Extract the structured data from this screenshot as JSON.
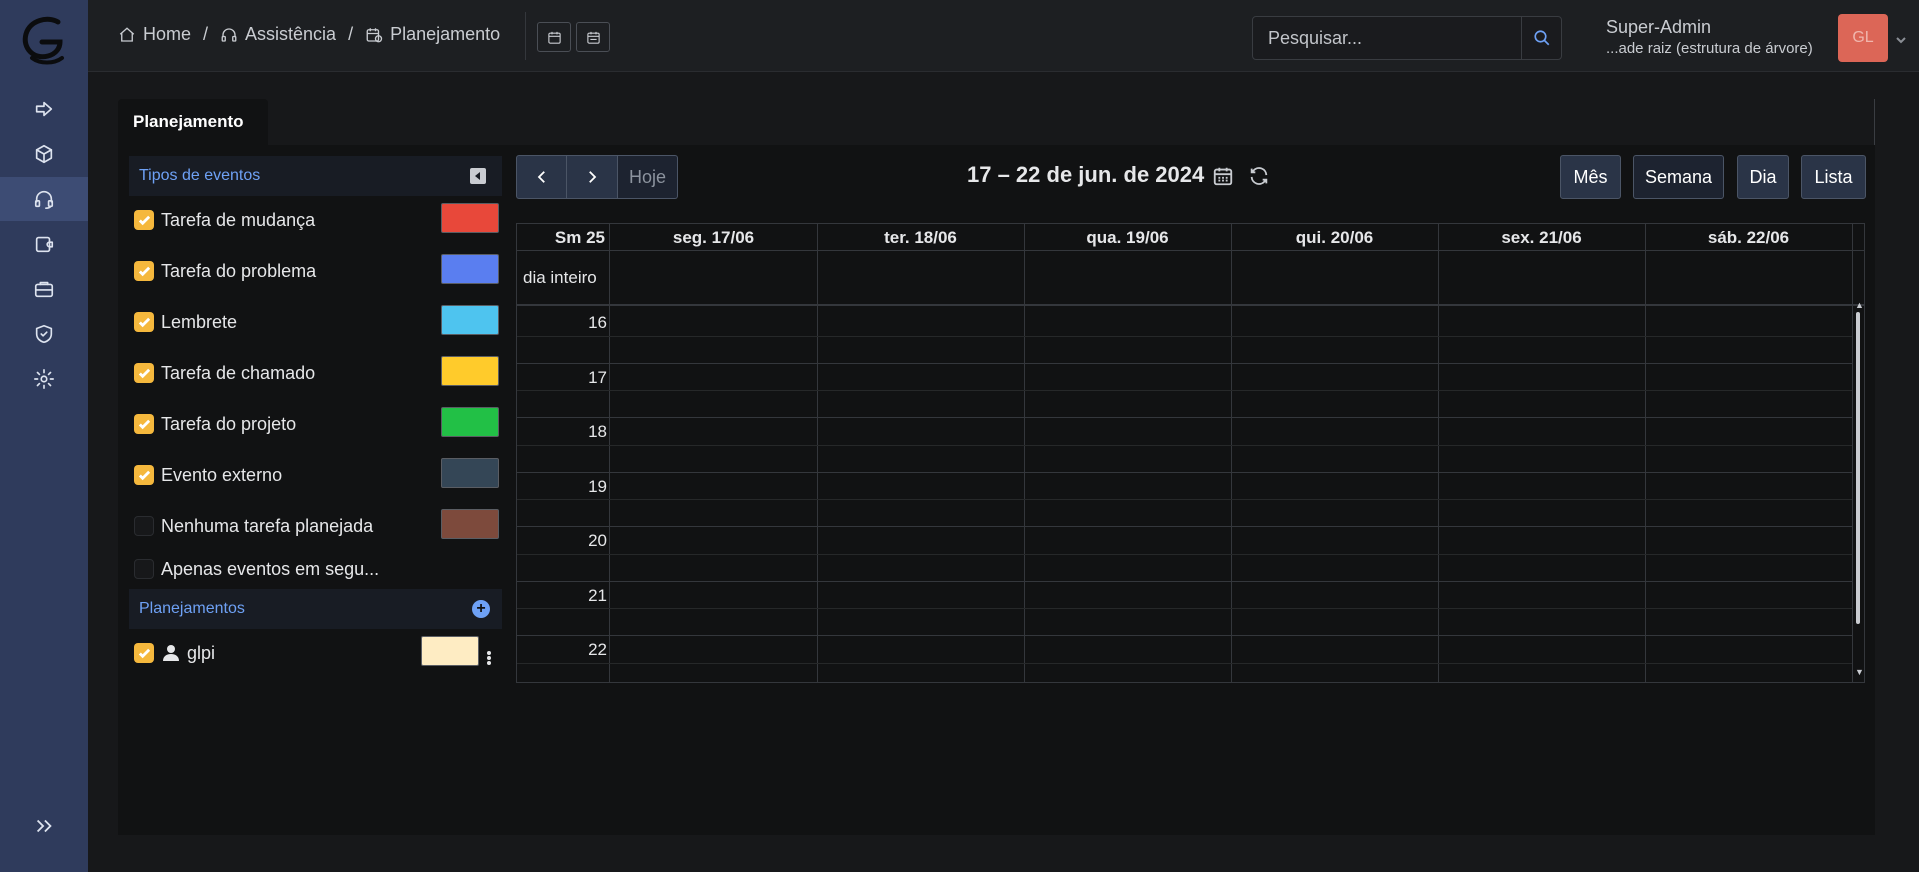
{
  "breadcrumb": {
    "home": "Home",
    "assistance": "Assistência",
    "planning": "Planejamento"
  },
  "search": {
    "placeholder": "Pesquisar..."
  },
  "user": {
    "name": "Super-Admin",
    "entity": "...ade raiz (estrutura de árvore)",
    "initials": "GL",
    "avatar_color": "#dc6657"
  },
  "sidebar": {
    "items": [
      {
        "icon": "arrow-right-icon"
      },
      {
        "icon": "box-icon"
      },
      {
        "icon": "headset-icon",
        "active": true
      },
      {
        "icon": "wallet-icon"
      },
      {
        "icon": "briefcase-icon"
      },
      {
        "icon": "shield-icon"
      },
      {
        "icon": "gear-icon"
      }
    ],
    "expand_icon": "chevrons-right-icon"
  },
  "tab": {
    "label": "Planejamento"
  },
  "filters": {
    "event_types_header": "Tipos de eventos",
    "event_types": [
      {
        "label": "Tarefa de mudança",
        "checked": true,
        "color": "#e8483a"
      },
      {
        "label": "Tarefa do problema",
        "checked": true,
        "color": "#5a7ef0"
      },
      {
        "label": "Lembrete",
        "checked": true,
        "color": "#4ec4ef"
      },
      {
        "label": "Tarefa de chamado",
        "checked": true,
        "color": "#ffcb2b"
      },
      {
        "label": "Tarefa do projeto",
        "checked": true,
        "color": "#22c046"
      },
      {
        "label": "Evento externo",
        "checked": true,
        "color": "#344656"
      },
      {
        "label": "Nenhuma tarefa planejada",
        "checked": false,
        "color": "#7d4a3c"
      },
      {
        "label": "Apenas eventos em segu...",
        "checked": false
      }
    ],
    "plannings_header": "Planejamentos",
    "plannings": [
      {
        "label": "glpi",
        "checked": true,
        "color": "#feecc3"
      }
    ]
  },
  "calendar": {
    "title": "17 – 22 de jun. de 2024",
    "today_label": "Hoje",
    "views": {
      "month": "Mês",
      "week": "Semana",
      "day": "Dia",
      "list": "Lista"
    },
    "week_label": "Sm 25",
    "days": [
      "seg. 17/06",
      "ter. 18/06",
      "qua. 19/06",
      "qui. 20/06",
      "sex. 21/06",
      "sáb. 22/06"
    ],
    "allday_label": "dia inteiro",
    "hours": [
      "16",
      "17",
      "18",
      "19",
      "20",
      "21",
      "22"
    ]
  },
  "colors": {
    "sidebar_bg": "#2f3b5c",
    "accent_blue": "#6ea1f5",
    "checkbox_checked": "#f5b83d"
  }
}
